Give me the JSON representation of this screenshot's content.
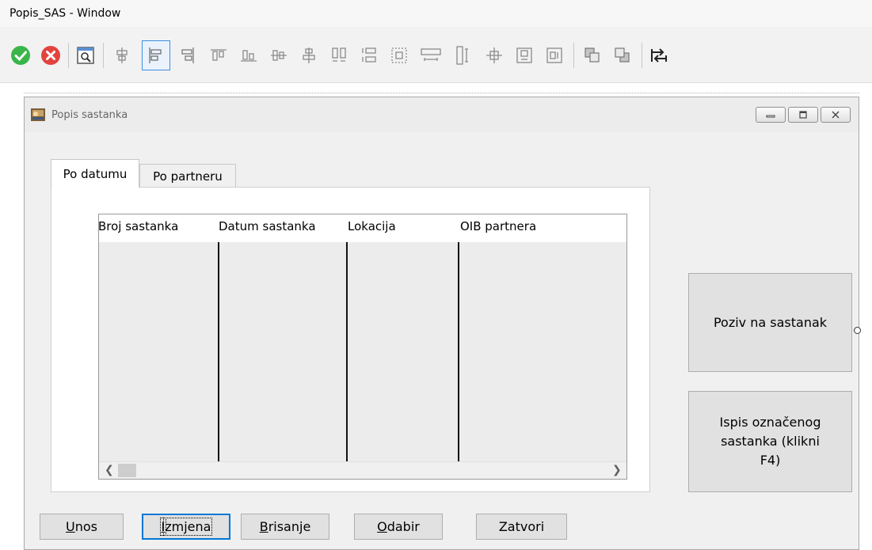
{
  "window": {
    "title": "Popis_SAS - Window"
  },
  "toolbar": {
    "buttons": [
      {
        "name": "ok",
        "icon": "green-check-icon"
      },
      {
        "name": "cancel",
        "icon": "red-x-icon"
      },
      {
        "name": "preview",
        "icon": "magnifier-icon"
      },
      {
        "name": "center-horizontal",
        "icon": "align-center-icon"
      },
      {
        "name": "align-left",
        "icon": "align-left-icon",
        "selected": true
      },
      {
        "name": "align-right",
        "icon": "align-right-icon"
      },
      {
        "name": "align-top",
        "icon": "align-top-icon"
      },
      {
        "name": "align-bottom",
        "icon": "align-bottom-icon"
      },
      {
        "name": "align-middle",
        "icon": "align-middle-icon"
      },
      {
        "name": "align-center",
        "icon": "align-center-vertical-icon"
      },
      {
        "name": "same-width",
        "icon": "same-width-icon"
      },
      {
        "name": "same-height",
        "icon": "same-height-icon"
      },
      {
        "name": "same-size",
        "icon": "same-size-icon"
      },
      {
        "name": "space-horizontal",
        "icon": "space-horizontal-icon"
      },
      {
        "name": "space-vertical",
        "icon": "space-vertical-icon"
      },
      {
        "name": "center-in-form",
        "icon": "center-in-form-icon"
      },
      {
        "name": "center-vertically",
        "icon": "center-vertically-icon"
      },
      {
        "name": "center-horizontally",
        "icon": "center-horizontally-icon"
      },
      {
        "name": "bring-to-front",
        "icon": "bring-to-front-icon"
      },
      {
        "name": "send-to-back",
        "icon": "send-to-back-icon"
      },
      {
        "name": "tab-order",
        "icon": "tab-order-icon"
      }
    ]
  },
  "form": {
    "title": "Popis sastanka",
    "tabs": [
      {
        "label": "Po datumu",
        "active": true
      },
      {
        "label": "Po partneru",
        "active": false
      }
    ],
    "grid": {
      "columns": [
        "Broj sastanka",
        "Datum sastanka",
        "Lokacija",
        "OIB partnera"
      ],
      "rows": []
    },
    "side_buttons": {
      "poziv": "Poziv na sastanak",
      "ispis_line1": "Ispis označenog",
      "ispis_line2": "sastanka (klikni",
      "ispis_line3": "F4)"
    },
    "bottom_buttons": {
      "unos_key": "U",
      "unos_rest": "nos",
      "izmjena_key": "I",
      "izmjena_rest": "zmjena",
      "brisanje_key": "B",
      "brisanje_rest": "risanje",
      "odabir_key": "O",
      "odabir_rest": "dabir",
      "zatvori": "Zatvori"
    }
  }
}
